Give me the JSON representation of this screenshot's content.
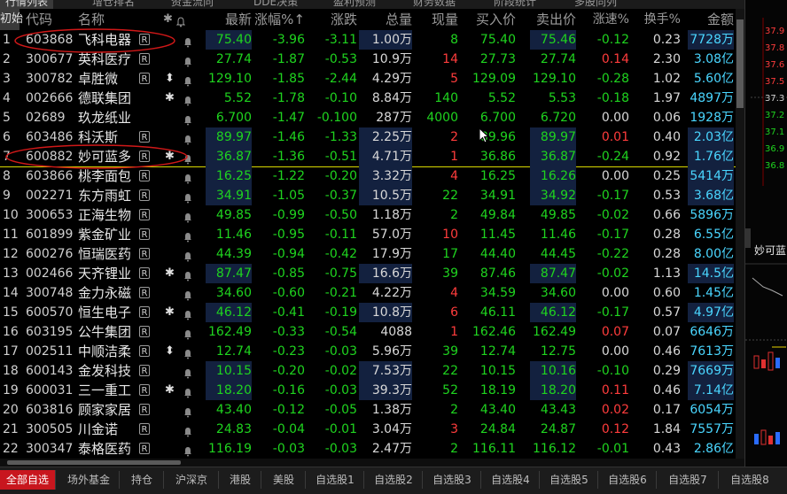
{
  "top_tabs": [
    "行情列表",
    "增仓排名",
    "资金流向",
    "DDE决策",
    "盈利预测",
    "财务数据",
    "阶段统计",
    "多股同列"
  ],
  "columns": {
    "first": "初始",
    "code": "代码",
    "name": "称",
    "name_prefix": "名",
    "mark": "✱",
    "price": "最新",
    "chg_pct": "涨幅%↑",
    "chg": "涨跌",
    "volume": "总量",
    "cur": "现量",
    "bid": "买入价",
    "ask": "卖出价",
    "speed": "涨速%",
    "turnover": "换手%",
    "amount": "金额"
  },
  "rows": [
    {
      "idx": "1",
      "code": "603868",
      "name": "飞科电器",
      "r": "R",
      "mk": "",
      "price": "75.40",
      "chg_pct": "-3.96",
      "chg": "-3.11",
      "volume": "1.00万",
      "cur": "8",
      "cur_c": "g",
      "bid": "75.40",
      "ask": "75.46",
      "speed": "-0.12",
      "speed_c": "g",
      "turnover": "0.23",
      "amount": "7728万",
      "hl": true
    },
    {
      "idx": "2",
      "code": "300677",
      "name": "英科医疗",
      "r": "R",
      "mk": "",
      "price": "27.74",
      "chg_pct": "-1.87",
      "chg": "-0.53",
      "volume": "10.9万",
      "cur": "14",
      "cur_c": "rd",
      "bid": "27.73",
      "ask": "27.74",
      "speed": "0.14",
      "speed_c": "rd",
      "turnover": "2.30",
      "amount": "3.08亿",
      "hl": false
    },
    {
      "idx": "3",
      "code": "300782",
      "name": "卓胜微",
      "r": "R",
      "mk": "⬍",
      "price": "129.10",
      "chg_pct": "-1.85",
      "chg": "-2.44",
      "volume": "4.29万",
      "cur": "5",
      "cur_c": "rd",
      "bid": "129.09",
      "ask": "129.10",
      "speed": "-0.28",
      "speed_c": "g",
      "turnover": "1.02",
      "amount": "5.60亿",
      "hl": false
    },
    {
      "idx": "4",
      "code": "002666",
      "name": "德联集团",
      "r": "",
      "mk": "✱",
      "price": "5.52",
      "chg_pct": "-1.78",
      "chg": "-0.10",
      "volume": "8.84万",
      "cur": "140",
      "cur_c": "g",
      "bid": "5.52",
      "ask": "5.53",
      "speed": "-0.18",
      "speed_c": "g",
      "turnover": "1.97",
      "amount": "4897万",
      "hl": false
    },
    {
      "idx": "5",
      "code": "02689",
      "name": "玖龙纸业",
      "r": "",
      "mk": "",
      "price": "6.700",
      "chg_pct": "-1.47",
      "chg": "-0.100",
      "volume": "287万",
      "cur": "4000",
      "cur_c": "g",
      "bid": "6.700",
      "ask": "6.720",
      "speed": "0.00",
      "speed_c": "w",
      "turnover": "0.06",
      "amount": "1928万",
      "hl": false
    },
    {
      "idx": "6",
      "code": "603486",
      "name": "科沃斯",
      "r": "R",
      "mk": "",
      "price": "89.97",
      "chg_pct": "-1.46",
      "chg": "-1.33",
      "volume": "2.25万",
      "cur": "2",
      "cur_c": "rd",
      "bid": "89.96",
      "ask": "89.97",
      "speed": "0.01",
      "speed_c": "rd",
      "turnover": "0.40",
      "amount": "2.03亿",
      "hl": true
    },
    {
      "idx": "7",
      "code": "600882",
      "name": "妙可蓝多",
      "r": "R",
      "mk": "✱",
      "price": "36.87",
      "chg_pct": "-1.36",
      "chg": "-0.51",
      "volume": "4.71万",
      "cur": "1",
      "cur_c": "rd",
      "bid": "36.86",
      "ask": "36.87",
      "speed": "-0.24",
      "speed_c": "g",
      "turnover": "0.92",
      "amount": "1.76亿",
      "hl": true
    },
    {
      "idx": "8",
      "code": "603866",
      "name": "桃李面包",
      "r": "R",
      "mk": "",
      "price": "16.25",
      "chg_pct": "-1.22",
      "chg": "-0.20",
      "volume": "3.32万",
      "cur": "4",
      "cur_c": "rd",
      "bid": "16.25",
      "ask": "16.26",
      "speed": "0.00",
      "speed_c": "w",
      "turnover": "0.25",
      "amount": "5414万",
      "hl": true
    },
    {
      "idx": "9",
      "code": "002271",
      "name": "东方雨虹",
      "r": "R",
      "mk": "",
      "price": "34.91",
      "chg_pct": "-1.05",
      "chg": "-0.37",
      "volume": "10.5万",
      "cur": "22",
      "cur_c": "g",
      "bid": "34.91",
      "ask": "34.92",
      "speed": "-0.17",
      "speed_c": "g",
      "turnover": "0.53",
      "amount": "3.68亿",
      "hl": true
    },
    {
      "idx": "10",
      "code": "300653",
      "name": "正海生物",
      "r": "R",
      "mk": "",
      "price": "49.85",
      "chg_pct": "-0.99",
      "chg": "-0.50",
      "volume": "1.18万",
      "cur": "2",
      "cur_c": "g",
      "bid": "49.84",
      "ask": "49.85",
      "speed": "-0.02",
      "speed_c": "g",
      "turnover": "0.66",
      "amount": "5896万",
      "hl": false
    },
    {
      "idx": "11",
      "code": "601899",
      "name": "紫金矿业",
      "r": "R",
      "mk": "",
      "price": "11.46",
      "chg_pct": "-0.95",
      "chg": "-0.11",
      "volume": "57.0万",
      "cur": "10",
      "cur_c": "rd",
      "bid": "11.45",
      "ask": "11.46",
      "speed": "-0.17",
      "speed_c": "g",
      "turnover": "0.28",
      "amount": "6.55亿",
      "hl": false
    },
    {
      "idx": "12",
      "code": "600276",
      "name": "恒瑞医药",
      "r": "R",
      "mk": "",
      "price": "44.39",
      "chg_pct": "-0.94",
      "chg": "-0.42",
      "volume": "17.9万",
      "cur": "17",
      "cur_c": "g",
      "bid": "44.40",
      "ask": "44.45",
      "speed": "-0.22",
      "speed_c": "g",
      "turnover": "0.28",
      "amount": "8.00亿",
      "hl": false
    },
    {
      "idx": "13",
      "code": "002466",
      "name": "天齐锂业",
      "r": "R",
      "mk": "✱",
      "price": "87.47",
      "chg_pct": "-0.85",
      "chg": "-0.75",
      "volume": "16.6万",
      "cur": "39",
      "cur_c": "g",
      "bid": "87.46",
      "ask": "87.47",
      "speed": "-0.02",
      "speed_c": "g",
      "turnover": "1.13",
      "amount": "14.5亿",
      "hl": true
    },
    {
      "idx": "14",
      "code": "300748",
      "name": "金力永磁",
      "r": "R",
      "mk": "",
      "price": "34.60",
      "chg_pct": "-0.60",
      "chg": "-0.21",
      "volume": "4.22万",
      "cur": "4",
      "cur_c": "rd",
      "bid": "34.59",
      "ask": "34.60",
      "speed": "0.00",
      "speed_c": "w",
      "turnover": "0.60",
      "amount": "1.45亿",
      "hl": false
    },
    {
      "idx": "15",
      "code": "600570",
      "name": "恒生电子",
      "r": "R",
      "mk": "✱",
      "price": "46.12",
      "chg_pct": "-0.41",
      "chg": "-0.19",
      "volume": "10.8万",
      "cur": "6",
      "cur_c": "rd",
      "bid": "46.11",
      "ask": "46.12",
      "speed": "-0.17",
      "speed_c": "g",
      "turnover": "0.57",
      "amount": "4.97亿",
      "hl": true
    },
    {
      "idx": "16",
      "code": "603195",
      "name": "公牛集团",
      "r": "R",
      "mk": "",
      "price": "162.49",
      "chg_pct": "-0.33",
      "chg": "-0.54",
      "volume": "4088",
      "cur": "1",
      "cur_c": "rd",
      "bid": "162.46",
      "ask": "162.49",
      "speed": "0.07",
      "speed_c": "rd",
      "turnover": "0.07",
      "amount": "6646万",
      "hl": false
    },
    {
      "idx": "17",
      "code": "002511",
      "name": "中顺洁柔",
      "r": "R",
      "mk": "⬍",
      "price": "12.74",
      "chg_pct": "-0.23",
      "chg": "-0.03",
      "volume": "5.96万",
      "cur": "39",
      "cur_c": "g",
      "bid": "12.74",
      "ask": "12.75",
      "speed": "0.00",
      "speed_c": "w",
      "turnover": "0.46",
      "amount": "7613万",
      "hl": false
    },
    {
      "idx": "18",
      "code": "600143",
      "name": "金发科技",
      "r": "R",
      "mk": "",
      "price": "10.15",
      "chg_pct": "-0.20",
      "chg": "-0.02",
      "volume": "7.53万",
      "cur": "22",
      "cur_c": "g",
      "bid": "10.15",
      "ask": "10.16",
      "speed": "-0.10",
      "speed_c": "g",
      "turnover": "0.29",
      "amount": "7669万",
      "hl": true
    },
    {
      "idx": "19",
      "code": "600031",
      "name": "三一重工",
      "r": "R",
      "mk": "✱",
      "price": "18.20",
      "chg_pct": "-0.16",
      "chg": "-0.03",
      "volume": "39.3万",
      "cur": "52",
      "cur_c": "g",
      "bid": "18.19",
      "ask": "18.20",
      "speed": "0.11",
      "speed_c": "rd",
      "turnover": "0.46",
      "amount": "7.14亿",
      "hl": true
    },
    {
      "idx": "20",
      "code": "603816",
      "name": "顾家家居",
      "r": "R",
      "mk": "",
      "price": "43.40",
      "chg_pct": "-0.12",
      "chg": "-0.05",
      "volume": "1.38万",
      "cur": "2",
      "cur_c": "g",
      "bid": "43.40",
      "ask": "43.43",
      "speed": "0.02",
      "speed_c": "rd",
      "turnover": "0.17",
      "amount": "6054万",
      "hl": false
    },
    {
      "idx": "21",
      "code": "300505",
      "name": "川金诺",
      "r": "R",
      "mk": "",
      "price": "24.83",
      "chg_pct": "-0.04",
      "chg": "-0.01",
      "volume": "3.04万",
      "cur": "3",
      "cur_c": "rd",
      "bid": "24.84",
      "ask": "24.87",
      "speed": "0.12",
      "speed_c": "rd",
      "turnover": "1.84",
      "amount": "7557万",
      "hl": false
    },
    {
      "idx": "22",
      "code": "300347",
      "name": "泰格医药",
      "r": "R",
      "mk": "",
      "price": "116.19",
      "chg_pct": "-0.03",
      "chg": "-0.03",
      "volume": "2.47万",
      "cur": "2",
      "cur_c": "g",
      "bid": "116.11",
      "ask": "116.12",
      "speed": "-0.01",
      "speed_c": "g",
      "turnover": "0.43",
      "amount": "2.86亿",
      "hl": false
    }
  ],
  "bottom_tabs": [
    "全部自选",
    "场外基金",
    "持仓",
    "沪深京",
    "港股",
    "美股",
    "自选股1",
    "自选股2",
    "自选股3",
    "自选股4",
    "自选股5",
    "自选股6",
    "自选股7",
    "自选股8"
  ],
  "right_panel": {
    "prices": [
      "37.9",
      "37.8",
      "37.6",
      "37.5",
      "37.3",
      "37.2",
      "37.1",
      "36.9",
      "36.8"
    ],
    "title": "妙可蓝"
  }
}
